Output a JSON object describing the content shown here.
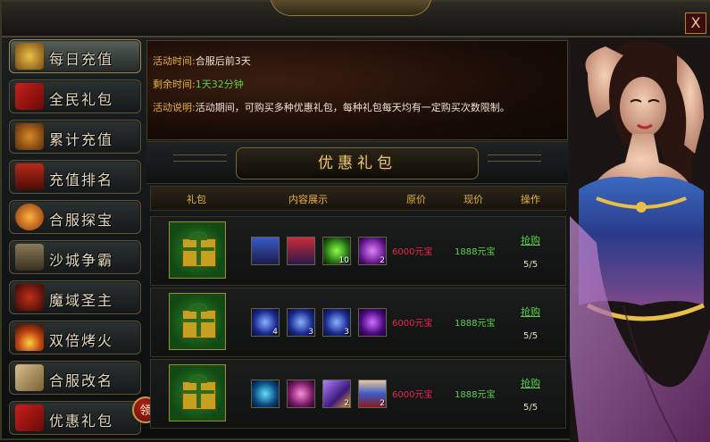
{
  "window": {
    "close_label": "X",
    "banner_title": "优惠礼包"
  },
  "sidebar": {
    "items": [
      {
        "label": "每日充值",
        "icon": "treasure-chest-icon",
        "active": true
      },
      {
        "label": "全民礼包",
        "icon": "gift-box-icon",
        "active": false
      },
      {
        "label": "累计充值",
        "icon": "money-bag-icon",
        "active": false
      },
      {
        "label": "充值排名",
        "icon": "banner-flag-icon",
        "active": false
      },
      {
        "label": "合服探宝",
        "icon": "fire-orb-icon",
        "active": false
      },
      {
        "label": "沙城争霸",
        "icon": "castle-icon",
        "active": false
      },
      {
        "label": "魔域圣主",
        "icon": "demon-mask-icon",
        "active": false
      },
      {
        "label": "双倍烤火",
        "icon": "campfire-icon",
        "active": false
      },
      {
        "label": "合服改名",
        "icon": "scroll-icon",
        "active": false
      },
      {
        "label": "优惠礼包",
        "icon": "gift-box-icon",
        "active": false
      }
    ],
    "claim_badge": "领"
  },
  "info": {
    "time_key": "活动时间:",
    "time_val": "合服后前3天",
    "remain_key": "剩余时间:",
    "remain_val": "1天32分钟",
    "desc_key": "活动说明:",
    "desc_val": "活动期间，可购买多种优惠礼包，每种礼包每天均有一定购买次数限制。"
  },
  "table": {
    "headers": {
      "gift": "礼包",
      "content": "内容展示",
      "original": "原价",
      "current": "现价",
      "action": "操作"
    },
    "rows": [
      {
        "items": [
          {
            "icon": "armor-robe-icon",
            "count": ""
          },
          {
            "icon": "armor-robe-icon",
            "count": ""
          },
          {
            "icon": "green-orb-icon",
            "count": "10"
          },
          {
            "icon": "purple-flame-icon",
            "count": "2"
          }
        ],
        "original_price": "6000元宝",
        "current_price": "1888元宝",
        "buy_label": "抢购",
        "limit": "5/5"
      },
      {
        "items": [
          {
            "icon": "blue-orb-icon",
            "count": "4"
          },
          {
            "icon": "blue-orb-icon",
            "count": "3"
          },
          {
            "icon": "blue-orb-icon",
            "count": "3"
          },
          {
            "icon": "purple-orb-icon",
            "count": ""
          }
        ],
        "original_price": "6000元宝",
        "current_price": "1888元宝",
        "buy_label": "抢购",
        "limit": "5/5"
      },
      {
        "items": [
          {
            "icon": "blue-wing-icon",
            "count": ""
          },
          {
            "icon": "pink-gem-icon",
            "count": ""
          },
          {
            "icon": "purple-scroll-icon",
            "count": "2"
          },
          {
            "icon": "armor-suit-icon",
            "count": "2"
          }
        ],
        "original_price": "6000元宝",
        "current_price": "1888元宝",
        "buy_label": "抢购",
        "limit": "5/5"
      }
    ]
  },
  "colors": {
    "accent_gold": "#e7b23a",
    "price_red": "#e8264a",
    "price_green": "#5ad04a"
  }
}
